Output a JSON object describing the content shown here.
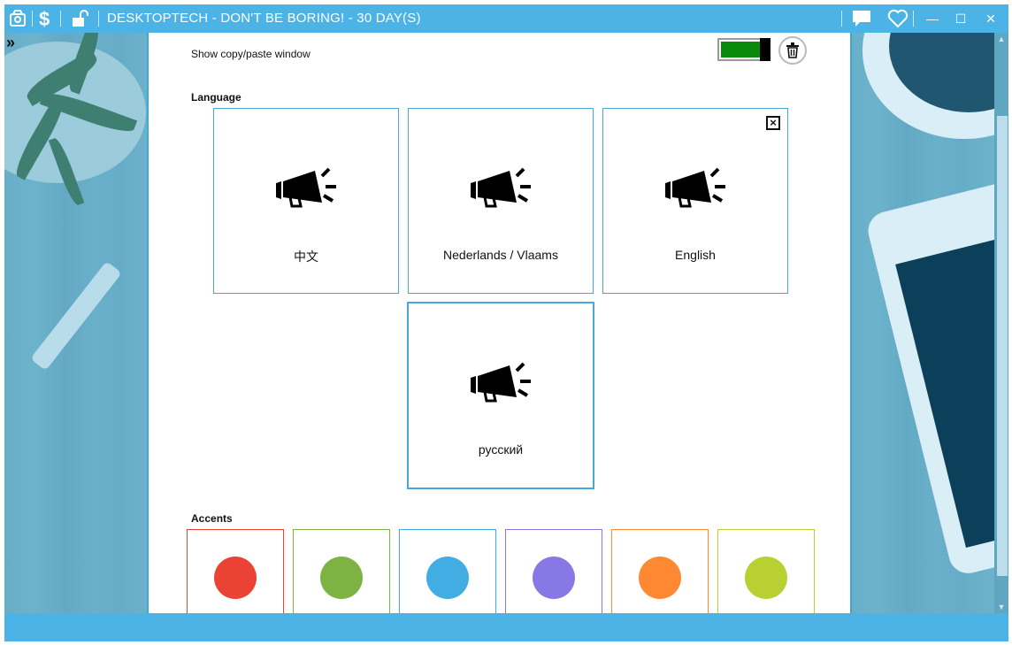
{
  "window": {
    "title": "DESKTOPTECH - DON'T BE BORING! - 30 DAY(S)",
    "toolbar_icons": [
      "app-logo-icon",
      "dollar-icon",
      "unlock-icon"
    ],
    "right_icons": [
      "chat-icon",
      "heart-icon"
    ],
    "controls": {
      "minimize": "—",
      "maximize": "☐",
      "close": "✕"
    }
  },
  "sidebar_toggle": {
    "icon": "double-chevron-right-icon",
    "glyph": "»"
  },
  "settings": {
    "copy_paste_label": "Show copy/paste window",
    "copy_paste_enabled": true,
    "toggle_color": "#0a8a0a"
  },
  "language": {
    "heading": "Language",
    "options": [
      {
        "label": "中文",
        "selected": false,
        "removable": false
      },
      {
        "label": "Nederlands / Vlaams",
        "selected": false,
        "removable": false
      },
      {
        "label": "English",
        "selected": false,
        "removable": true
      },
      {
        "label": "русский",
        "selected": true,
        "removable": false
      }
    ]
  },
  "accents": {
    "heading": "Accents",
    "colors": [
      {
        "name": "red",
        "color": "#ea4335"
      },
      {
        "name": "green",
        "color": "#7cb342"
      },
      {
        "name": "blue",
        "color": "#42ade2"
      },
      {
        "name": "purple",
        "color": "#8878e6"
      },
      {
        "name": "orange",
        "color": "#ff8833"
      },
      {
        "name": "lime",
        "color": "#b8d032"
      }
    ]
  }
}
